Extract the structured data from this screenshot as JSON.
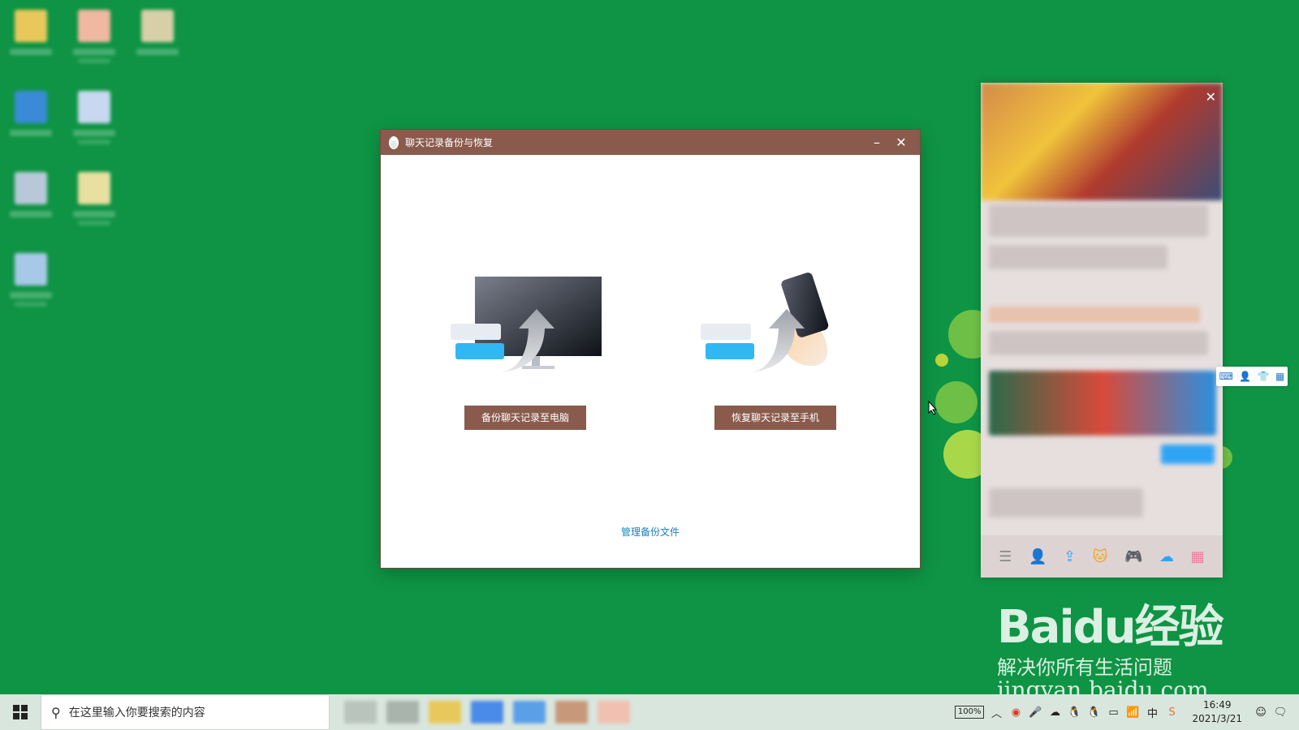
{
  "dialog": {
    "title": "聊天记录备份与恢复",
    "minimize_label": "–",
    "close_label": "✕",
    "backup_button": "备份聊天记录至电脑",
    "restore_button": "恢复聊天记录至手机",
    "manage_link": "管理备份文件"
  },
  "taskbar": {
    "search_placeholder": "在这里输入你要搜索的内容",
    "battery": "100%",
    "time": "16:49",
    "date": "2021/3/21",
    "ime": "中"
  },
  "watermark": {
    "brand": "Baidu经验",
    "slogan": "解决你所有生活问题",
    "url": "jingyan.baidu.com"
  },
  "qq_panel": {
    "close_label": "✕"
  },
  "colors": {
    "desktop": "#0e9444",
    "titlebar": "#8a5b4c",
    "link": "#1a7fc1"
  }
}
